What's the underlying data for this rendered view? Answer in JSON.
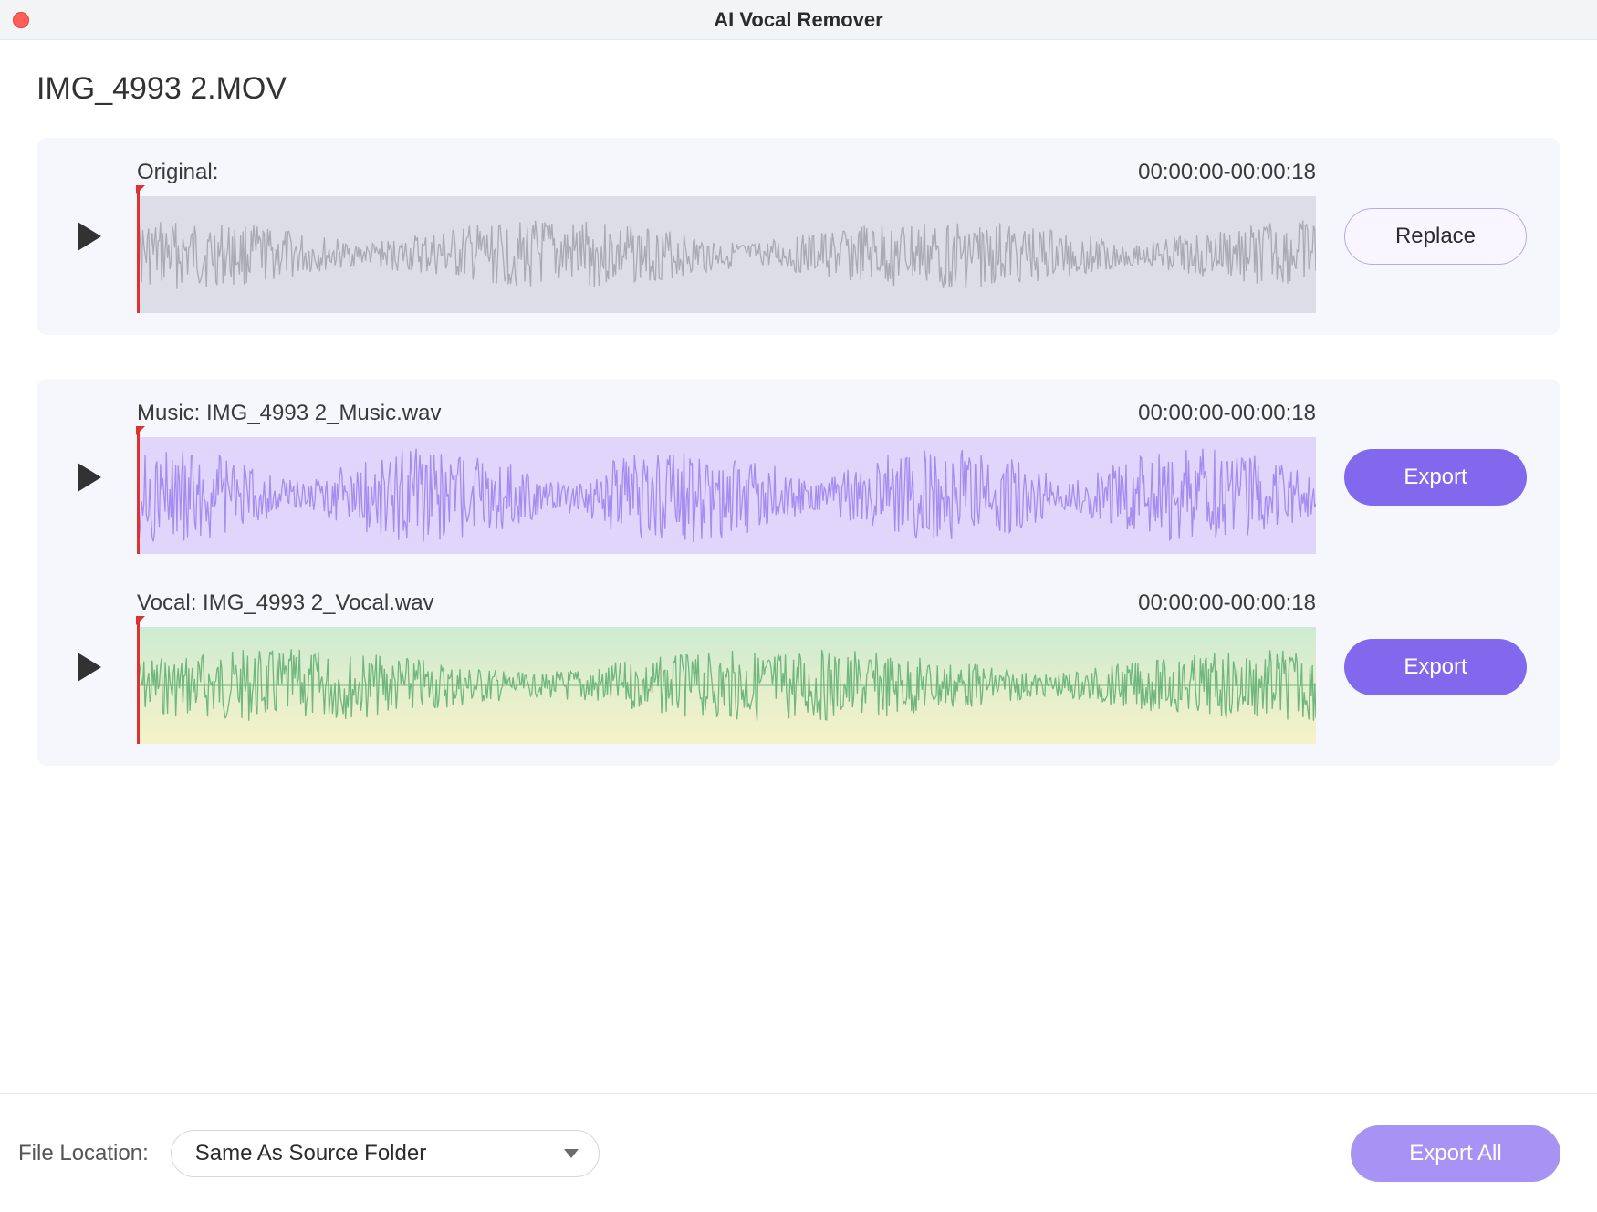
{
  "window": {
    "title": "AI Vocal Remover"
  },
  "file_name": "IMG_4993 2.MOV",
  "tracks": {
    "original": {
      "label": "Original:",
      "time": "00:00:00-00:00:18",
      "button": "Replace"
    },
    "music": {
      "label": "Music: IMG_4993 2_Music.wav",
      "time": "00:00:00-00:00:18",
      "button": "Export"
    },
    "vocal": {
      "label": "Vocal: IMG_4993 2_Vocal.wav",
      "time": "00:00:00-00:00:18",
      "button": "Export"
    }
  },
  "footer": {
    "file_location_label": "File Location:",
    "file_location_value": "Same As Source Folder",
    "export_all": "Export All"
  },
  "colors": {
    "accent": "#8268ec",
    "accent_light": "#a693f3",
    "wave_original": "#a9aab3",
    "wave_music": "#a58cf0",
    "wave_vocal": "#6fb77e",
    "cursor": "#e03131"
  }
}
